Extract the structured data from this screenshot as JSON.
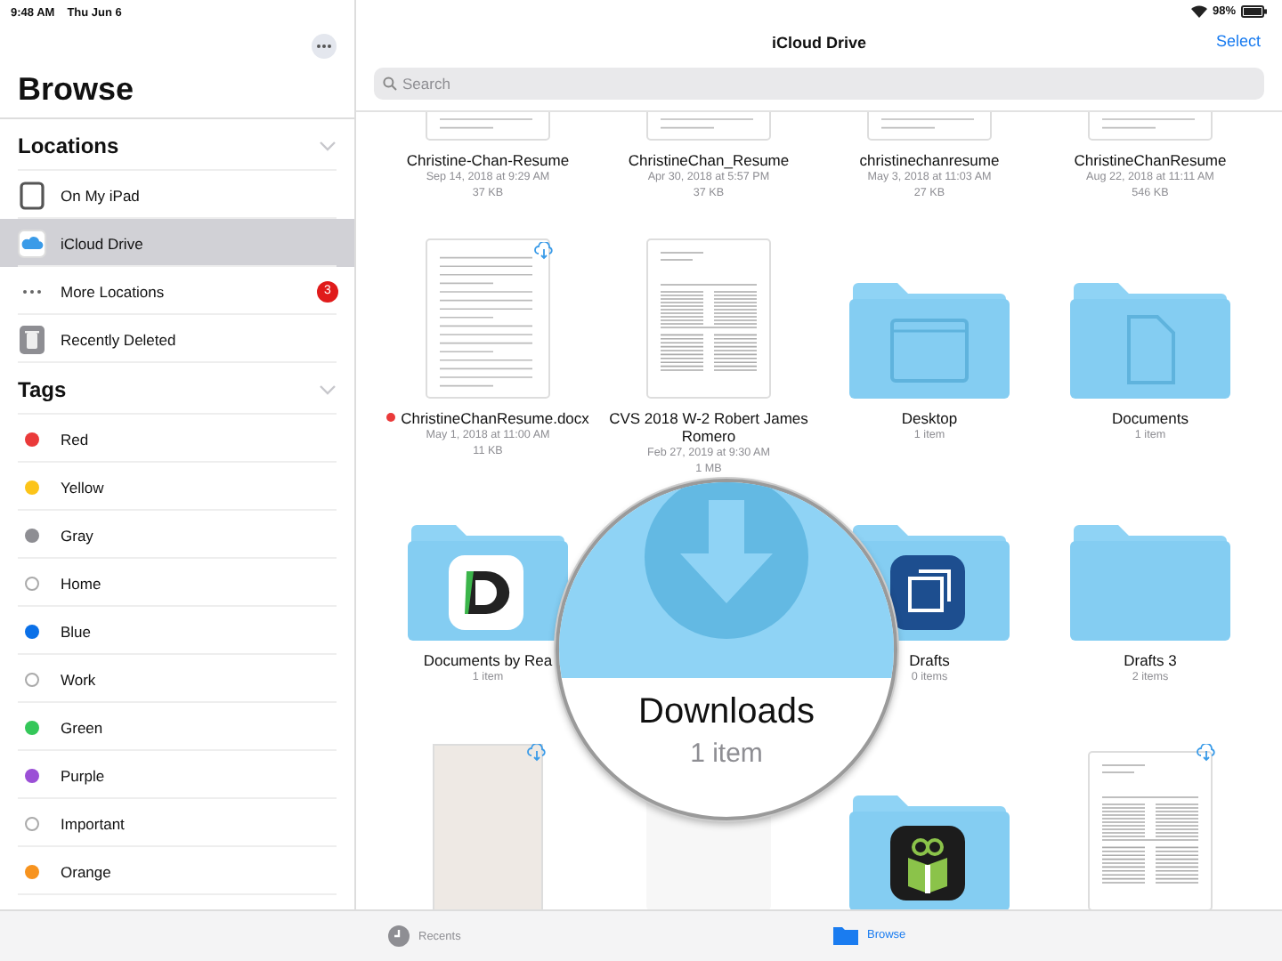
{
  "status_bar": {
    "time": "9:48 AM",
    "date": "Thu Jun 6",
    "battery": "98%"
  },
  "sidebar": {
    "title": "Browse",
    "locations": {
      "title": "Locations",
      "expanded": true,
      "items": [
        {
          "kind": "ipad",
          "label": "On My iPad",
          "selected": false
        },
        {
          "kind": "icloud",
          "label": "iCloud Drive",
          "selected": true
        },
        {
          "kind": "more",
          "label": "More Locations",
          "selected": false,
          "badge": "3"
        },
        {
          "kind": "trash",
          "label": "Recently Deleted",
          "selected": false
        }
      ]
    },
    "tags": {
      "title": "Tags",
      "expanded": true,
      "items": [
        {
          "label": "Red",
          "color": "#ea3a3a"
        },
        {
          "label": "Yellow",
          "color": "#fcc419"
        },
        {
          "label": "Gray",
          "color": "#8e8e93"
        },
        {
          "label": "Home"
        },
        {
          "label": "Blue",
          "color": "#0a70e8"
        },
        {
          "label": "Work"
        },
        {
          "label": "Green",
          "color": "#34c759"
        },
        {
          "label": "Purple",
          "color": "#9b4fd6"
        },
        {
          "label": "Important"
        },
        {
          "label": "Orange",
          "color": "#f7931e"
        }
      ]
    }
  },
  "header": {
    "title": "iCloud Drive",
    "action": "Select",
    "search_placeholder": "Search"
  },
  "rows": [
    {
      "items": [
        {
          "kind": "document",
          "name": "Christine-Chan-Resume",
          "date": "Sep 14, 2018 at 9:29 AM",
          "size": "37 KB"
        },
        {
          "kind": "document",
          "name": "ChristineChan_Resume",
          "date": "Apr 30, 2018 at 5:57 PM",
          "size": "37 KB"
        },
        {
          "kind": "document",
          "name": "christinechanresume",
          "date": "May 3, 2018 at 11:03 AM",
          "size": "27 KB"
        },
        {
          "kind": "document",
          "name": "ChristineChanResume",
          "date": "Aug 22, 2018 at 11:11 AM",
          "size": "546 KB"
        }
      ]
    },
    {
      "items": [
        {
          "kind": "document",
          "name": "ChristineChanResume.docx",
          "date": "May 1, 2018 at 11:00 AM",
          "size": "11 KB",
          "cloud": true,
          "color": "#ea3a3a"
        },
        {
          "kind": "form",
          "name": "CVS 2018 W-2 Robert James Romero",
          "date": "Feb 27, 2019 at 9:30 AM",
          "size": "1 MB"
        },
        {
          "kind": "window-folder",
          "name": "Desktop",
          "count": "1 item"
        },
        {
          "kind": "page-folder",
          "name": "Documents",
          "count": "1 item"
        }
      ]
    },
    {
      "items": [
        {
          "kind": "d-app-folder",
          "name": "Documents by Rea",
          "count": "1 item"
        },
        {
          "kind": "magnified-folder",
          "name": "Downloads",
          "count": "1 item"
        },
        {
          "kind": "square-app-folder",
          "name": "Drafts",
          "count": "0 items"
        },
        {
          "kind": "folder",
          "name": "Drafts 3",
          "count": "2 items"
        }
      ]
    },
    {
      "items": [
        {
          "kind": "book",
          "cloud": true
        },
        {
          "kind": "blank"
        },
        {
          "kind": "gift-app-folder"
        },
        {
          "kind": "form",
          "cloud": true
        }
      ]
    }
  ],
  "tab_bar": [
    {
      "kind": "recents",
      "label": "Recents",
      "selected": false
    },
    {
      "kind": "browse",
      "label": "Browse",
      "selected": true
    }
  ]
}
